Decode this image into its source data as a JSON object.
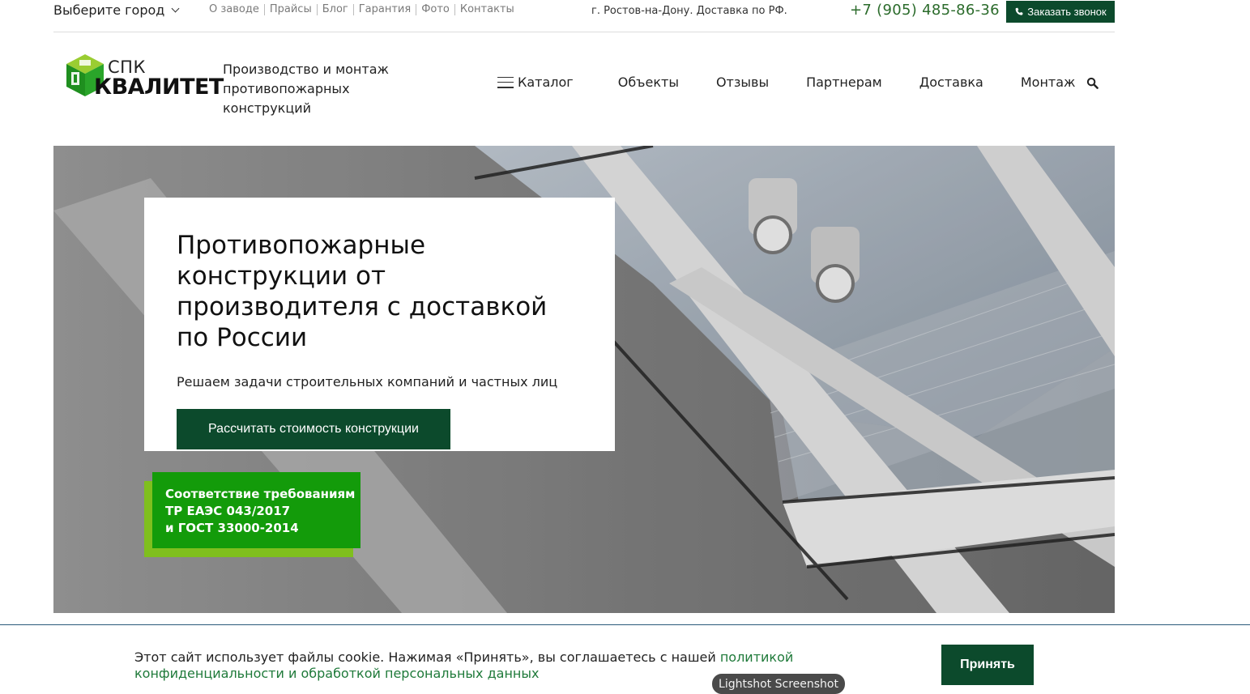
{
  "topbar": {
    "city_label": "Выберите город",
    "links": [
      "О заводе",
      "Прайсы",
      "Блог",
      "Гарантия",
      "Фото",
      "Контакты"
    ],
    "address": "г. Ростов-на-Дону. Доставка по РФ.",
    "phone": "+7 (905) 485-86-36",
    "callback_label": "Заказать звонок"
  },
  "header": {
    "logo_small": "СПК",
    "logo_name": "КВАЛИТЕТ",
    "tagline": "Производство и монтаж противопожарных конструкций",
    "nav": {
      "catalog": "Каталог",
      "objects": "Объекты",
      "reviews": "Отзывы",
      "partners": "Партнерам",
      "delivery": "Доставка",
      "mounting": "Монтаж"
    }
  },
  "hero": {
    "title": "Противопожарные конструкции от производителя с доставкой по России",
    "subtitle": "Решаем задачи строительных компаний и частных лиц",
    "cta": "Рассчитать стоимость конструкции",
    "badge_lines": [
      "Соответствие требованиям",
      "ТР ЕАЭС 043/2017",
      "и ГОСТ 33000-2014"
    ]
  },
  "cookie": {
    "text": "Этот сайт использует файлы cookie. Нажимая «Принять», вы соглашаетесь с нашей ",
    "link": "политикой конфиденциальности и обработкой персональных данных",
    "accept": "Принять"
  },
  "overlay": {
    "lightshot": "Lightshot Screenshot"
  },
  "colors": {
    "brand_dark_green": "#0c4a2c",
    "badge_green": "#139b0a",
    "badge_lime": "#7fbf1e",
    "phone_green": "#2b6b2b",
    "link_green": "#1f7a3a"
  },
  "icons": [
    "chevron-down-icon",
    "phone-icon",
    "menu-icon",
    "search-icon",
    "logo-icon"
  ]
}
